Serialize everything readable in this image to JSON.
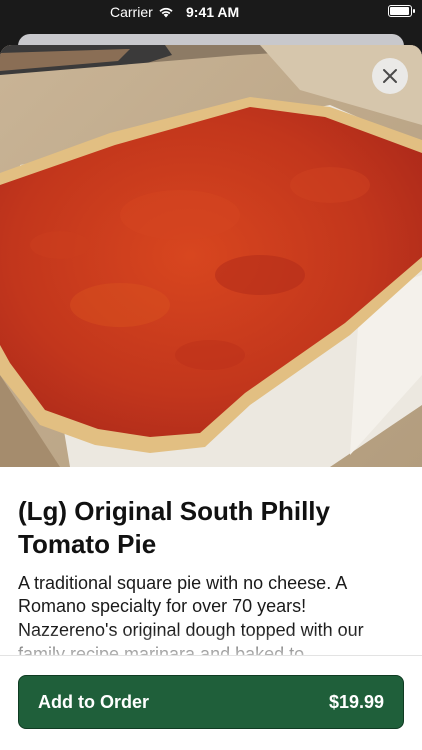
{
  "status_bar": {
    "carrier": "Carrier",
    "time": "9:41 AM"
  },
  "item": {
    "title": "(Lg) Original South Philly Tomato Pie",
    "description": "A traditional square pie with no cheese. A Romano specialty for over 70 years! Nazzereno's original dough topped with our family recipe marinara and baked to"
  },
  "actions": {
    "add_label": "Add to Order",
    "price": "$19.99"
  },
  "colors": {
    "button": "#1f5f3a",
    "sauce": "#c2361c",
    "crust": "#e2bf82"
  },
  "icons": {
    "close": "close-icon",
    "wifi": "wifi-icon",
    "battery": "battery-icon"
  }
}
